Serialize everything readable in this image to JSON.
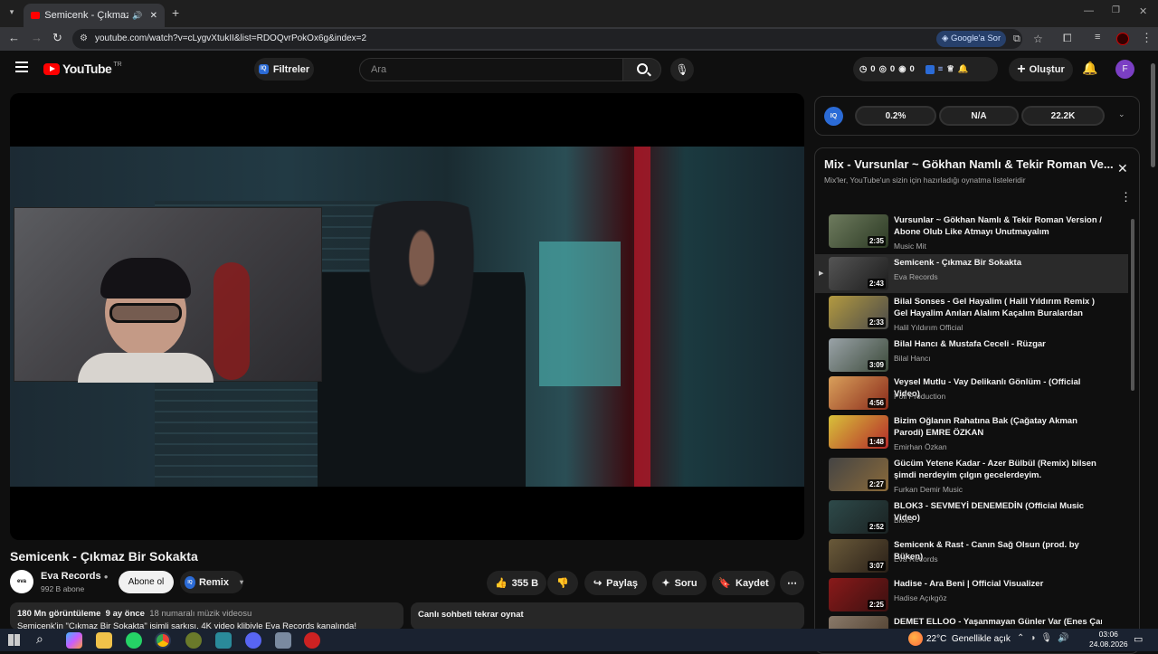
{
  "browser": {
    "tab_title": "Semicenk - Çıkmaz Bir Soka",
    "url": "youtube.com/watch?v=cLygvXtukII&list=RDOQvrPokOx6g&index=2",
    "google_sor": "Google'a Sor"
  },
  "yt": {
    "logo": "YouTube",
    "region": "TR",
    "filters": "Filtreler",
    "search_placeholder": "Ara",
    "stat_a": "0",
    "stat_b": "0",
    "stat_c": "0",
    "create": "Oluştur",
    "avatar": "F"
  },
  "video": {
    "title": "Semicenk - Çıkmaz Bir Sokakta",
    "channel": "Eva Records",
    "subs": "992 B abone",
    "subscribe": "Abone ol",
    "remix": "Remix",
    "likes": "355 B",
    "share": "Paylaş",
    "ask": "Soru",
    "save": "Kaydet",
    "views": "180 Mn görüntüleme",
    "age": "9 ay önce",
    "tag": "18 numaralı müzik videosu",
    "desc": "Semicenk'in \"Çıkmaz Bir Sokakta\" isimli şarkısı, 4K video klibiyle Eva Records kanalında!",
    "chat_replay": "Canlı sohbeti tekrar oynat"
  },
  "iq": {
    "label": "IQ",
    "v1": "0.2%",
    "v2": "N/A",
    "v3": "22.2K"
  },
  "playlist": {
    "title": "Mix - Vursunlar ~ Gökhan Namlı & Tekir Roman Ve...",
    "subtitle": "Mix'ler, YouTube'un sizin için hazırladığı oynatma listeleridir",
    "items": [
      {
        "title": "Vursunlar ~ Gökhan Namlı & Tekir Roman Version / Abone Olub Like Atmayı Unutmayalım",
        "channel": "Music Mit",
        "duration": "2:35"
      },
      {
        "title": "Semicenk - Çıkmaz Bir Sokakta",
        "channel": "Eva Records",
        "duration": "2:43"
      },
      {
        "title": "Bilal Sonses - Gel Hayalim ( Halil Yıldırım Remix ) Gel Hayalim Anıları Alalım Kaçalım Buralardan",
        "channel": "Halil Yıldırım Official",
        "duration": "2:33"
      },
      {
        "title": "Bilal Hancı & Mustafa Ceceli - Rüzgar",
        "channel": "Bilal Hancı",
        "duration": "3:09"
      },
      {
        "title": "Veysel Mutlu - Vay Delikanlı Gönlüm - (Official Video)",
        "channel": "Poll Production",
        "duration": "4:56"
      },
      {
        "title": "Bizim Oğlanın Rahatına Bak (Çağatay Akman Parodi) EMRE ÖZKAN",
        "channel": "Emirhan Özkan",
        "duration": "1:48"
      },
      {
        "title": "Gücüm Yetene Kadar - Azer Bülbül (Remix) bilsen şimdi nerdeyim çılgın gecelerdeyim.",
        "channel": "Furkan Demir Music",
        "duration": "2:27"
      },
      {
        "title": "BLOK3 - SEVMEYİ DENEMEDİN (Official Music Video)",
        "channel": "Blok3",
        "duration": "2:52"
      },
      {
        "title": "Semicenk & Rast - Canın Sağ Olsun (prod. by Büken)",
        "channel": "Eva Records",
        "duration": "3:07"
      },
      {
        "title": "Hadise - Ara Beni | Official Visualizer",
        "channel": "Hadise Açıkgöz",
        "duration": "2:25"
      },
      {
        "title": "DEMET ELLOO - Yaşanmayan Günler Var (Enes Çanta",
        "channel": "",
        "duration": ""
      }
    ]
  },
  "taskbar": {
    "temp": "22°C",
    "weather": "Genellikle açık",
    "time": "03:06",
    "date": "24.08.2026"
  }
}
